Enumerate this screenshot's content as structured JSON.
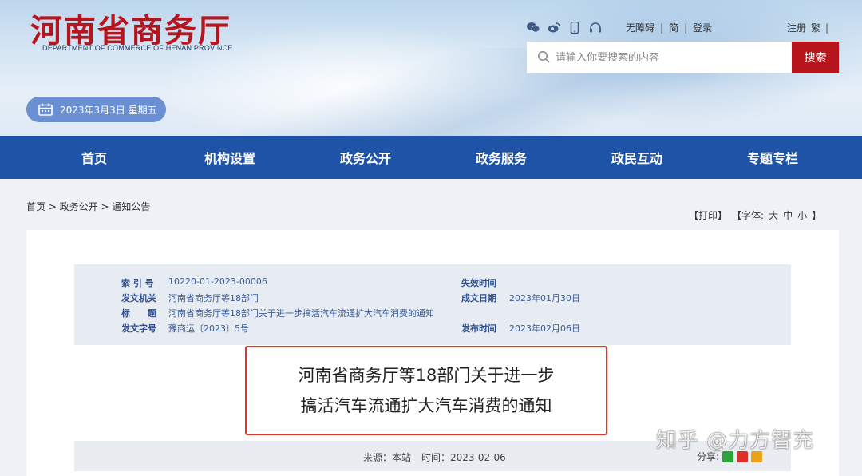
{
  "header": {
    "logo_cn": "河南省商务厅",
    "logo_en": "DEPARTMENT OF COMMERCE OF HENAN PROVINCE",
    "links": [
      "无障碍",
      "简",
      "登录"
    ],
    "links_right": [
      "注册",
      "繁"
    ],
    "search_placeholder": "请输入你要搜索的内容",
    "search_button": "搜索",
    "date": "2023年3月3日 星期五",
    "social_icons": [
      "wechat-icon",
      "weibo-icon",
      "mobile-icon",
      "headset-icon"
    ]
  },
  "nav": {
    "items": [
      "首页",
      "机构设置",
      "政务公开",
      "政务服务",
      "政民互动",
      "专题专栏"
    ]
  },
  "breadcrumb": "首页 > 政务公开 > 通知公告",
  "tools": {
    "print": "【打印】",
    "font_label": "【字体:",
    "big": "大",
    "mid": "中",
    "small": "小",
    "close": "】"
  },
  "meta": {
    "index_label": "索 引 号",
    "index_value": "10220-01-2023-00006",
    "issuer_label": "发文机关",
    "issuer_value": "河南省商务厅等18部门",
    "title_label": "标　　题",
    "title_value": "河南省商务厅等18部门关于进一步搞活汽车流通扩大汽车消费的通知",
    "docno_label": "发文字号",
    "docno_value": "豫商运〔2023〕5号",
    "expire_label": "失效时间",
    "expire_value": "",
    "written_label": "成文日期",
    "written_value": "2023年01月30日",
    "publish_label": "发布时间",
    "publish_value": "2023年02月06日"
  },
  "article": {
    "title_line1": "河南省商务厅等18部门关于进一步",
    "title_line2": "搞活汽车流通扩大汽车消费的通知",
    "source": "来源：本站",
    "time": "时间：2023-02-06",
    "share_label": "分享:"
  },
  "watermark": "知乎 @力方智充",
  "colors": {
    "brand_red": "#b8141c",
    "nav_blue": "#1f53a7",
    "date_pill": "#6a8fd2",
    "highlight_border": "#e0352b"
  }
}
